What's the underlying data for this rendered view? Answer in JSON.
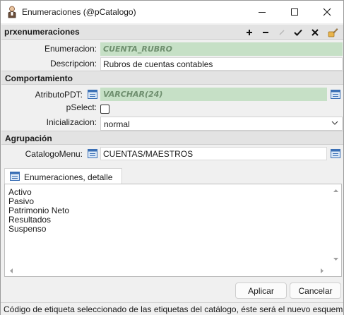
{
  "window": {
    "title": "Enumeraciones (@pCatalogo)"
  },
  "record": {
    "name": "prxenumeraciones"
  },
  "fields": {
    "enumeracion": {
      "label": "Enumeracion:",
      "value": "CUENTA_RUBRO"
    },
    "descripcion": {
      "label": "Descripcion:",
      "value": "Rubros de cuentas contables"
    }
  },
  "groups": {
    "comportamiento": "Comportamiento",
    "agrupacion": "Agrupación"
  },
  "comportamiento": {
    "atributo_label": "AtributoPDT:",
    "atributo_value": "VARCHAR(24)",
    "pselect_label": "pSelect:",
    "pselect_checked": false,
    "inicializacion_label": "Inicializacion:",
    "inicializacion_value": "normal"
  },
  "agrupacion": {
    "catalogo_label": "CatalogoMenu:",
    "catalogo_value": "CUENTAS/MAESTROS"
  },
  "tab": {
    "label": "Enumeraciones, detalle"
  },
  "detail_items": [
    "Activo",
    "Pasivo",
    "Patrimonio Neto",
    "Resultados",
    "Suspenso"
  ],
  "buttons": {
    "apply": "Aplicar",
    "cancel": "Cancelar"
  },
  "status": {
    "text": "Código de etiqueta seleccionado de las etiquetas del catálogo, éste será el nuevo esquema"
  },
  "colors": {
    "readonly_bg": "#c6e0c6",
    "accent_icon": "#3a6fb5",
    "group_header_bg": "#e3e3e3"
  }
}
